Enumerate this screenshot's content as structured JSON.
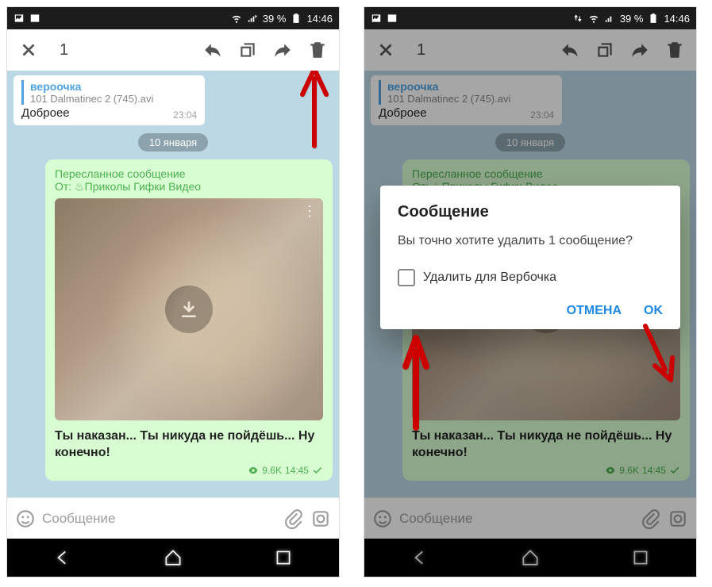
{
  "status": {
    "battery": "39 %",
    "time": "14:46"
  },
  "toolbar": {
    "count": "1"
  },
  "reply": {
    "name": "вероочка",
    "file": "101 Dalmatinec 2 (745).avi",
    "text": "Доброее",
    "time": "23:04"
  },
  "date": "10 января",
  "msg": {
    "fwd_label": "Пересланное сообщение",
    "fwd_from_prefix": "От:",
    "fwd_from_channel": "♨Приколы Гифки Видео",
    "caption": "Ты наказан... Ты никуда не пойдёшь... Ну конечно!",
    "views": "9.6K",
    "time": "14:45"
  },
  "input": {
    "placeholder": "Сообщение"
  },
  "dialog": {
    "title": "Сообщение",
    "body": "Вы точно хотите удалить 1 сообщение?",
    "check_label": "Удалить для Вербочка",
    "cancel": "ОТМЕНА",
    "ok": "OK"
  }
}
